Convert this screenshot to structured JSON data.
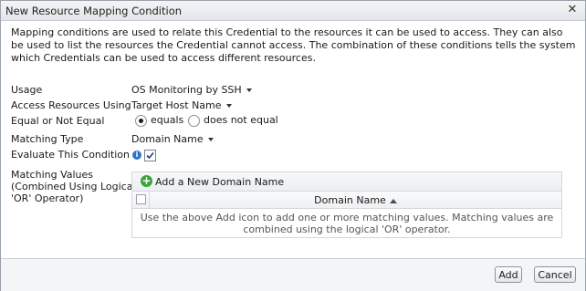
{
  "window": {
    "title": "New Resource Mapping Condition"
  },
  "description": "Mapping conditions are used to relate this Credential to the resources it can be used to access. They can also be used to list the resources the Credential cannot access. The combination of these conditions tells the system which Credentials can be used to access different resources.",
  "form": {
    "usage": {
      "label": "Usage",
      "value": "OS Monitoring by SSH"
    },
    "access": {
      "label": "Access Resources Using",
      "value": "Target Host Name"
    },
    "equal": {
      "label": "Equal or Not Equal",
      "options": [
        "equals",
        "does not equal"
      ],
      "selected": "equals"
    },
    "matching_type": {
      "label": "Matching Type",
      "value": "Domain Name"
    },
    "evaluate": {
      "label": "Evaluate This Condition",
      "checked": true
    },
    "matching_values": {
      "label_line1": "Matching Values",
      "label_line2": "(Combined Using Logical",
      "label_line3": "'OR' Operator)"
    }
  },
  "values_panel": {
    "add_label": "Add a New Domain Name",
    "column_header": "Domain Name",
    "empty_text": "Use the above Add icon to add one or more matching values. Matching values are combined using the logical 'OR' operator."
  },
  "buttons": {
    "add": "Add",
    "cancel": "Cancel"
  },
  "colors": {
    "info": "#2f73c9",
    "add_icon": "#3aa436"
  }
}
